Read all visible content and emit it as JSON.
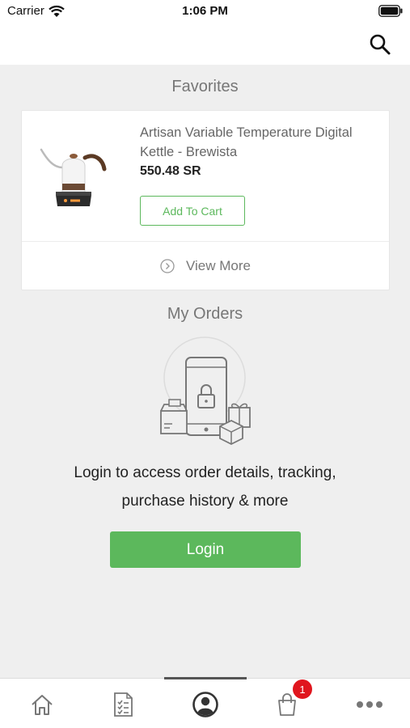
{
  "status_bar": {
    "carrier": "Carrier",
    "time": "1:06 PM"
  },
  "favorites": {
    "title": "Favorites",
    "product": {
      "name": "Artisan Variable Temperature Digital Kettle - Brewista",
      "price": "550.48 SR",
      "add_to_cart_label": "Add To Cart"
    },
    "view_more_label": "View More"
  },
  "orders": {
    "title": "My Orders",
    "message_line1": "Login to access order details, tracking,",
    "message_line2": "purchase history & more",
    "login_label": "Login"
  },
  "tab_bar": {
    "items": [
      {
        "icon": "home-icon"
      },
      {
        "icon": "list-icon"
      },
      {
        "icon": "account-icon",
        "selected": true
      },
      {
        "icon": "cart-icon",
        "badge": "1"
      },
      {
        "icon": "more-icon"
      }
    ]
  },
  "colors": {
    "accent": "#5cb85c",
    "badge": "#e0161e",
    "background": "#efefef"
  }
}
